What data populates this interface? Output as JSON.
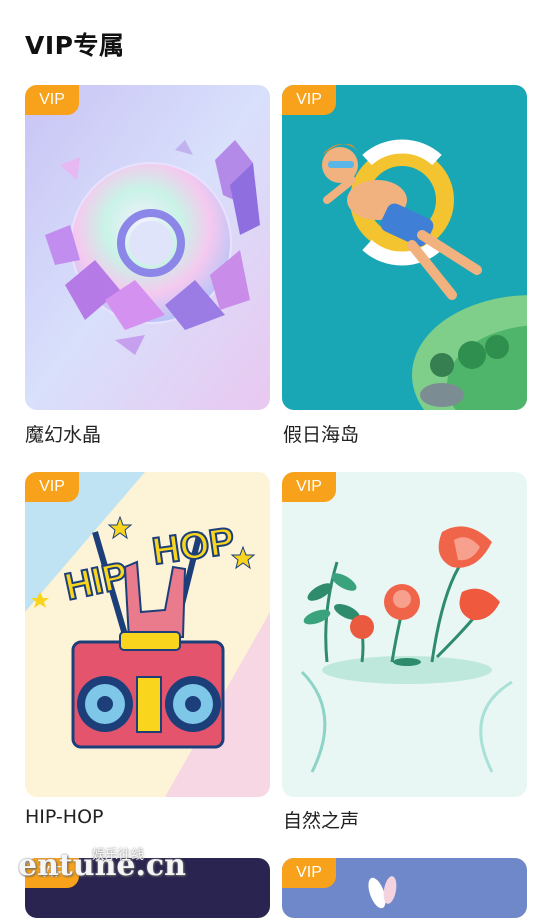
{
  "section": {
    "title": "VIP专属"
  },
  "badge": {
    "label": "VIP",
    "color": "#f7a21a"
  },
  "themes": [
    {
      "name": "魔幻水晶",
      "artwork": "crystal-disc"
    },
    {
      "name": "假日海岛",
      "artwork": "island-float"
    },
    {
      "name": "HIP-HOP",
      "artwork": "hiphop-boombox"
    },
    {
      "name": "自然之声",
      "artwork": "nature-flowers"
    },
    {
      "name": "",
      "artwork": "dark-partial"
    },
    {
      "name": "",
      "artwork": "bunny-partial"
    }
  ],
  "watermark": {
    "text": "entune.cn",
    "sub": "娱乐往线"
  }
}
